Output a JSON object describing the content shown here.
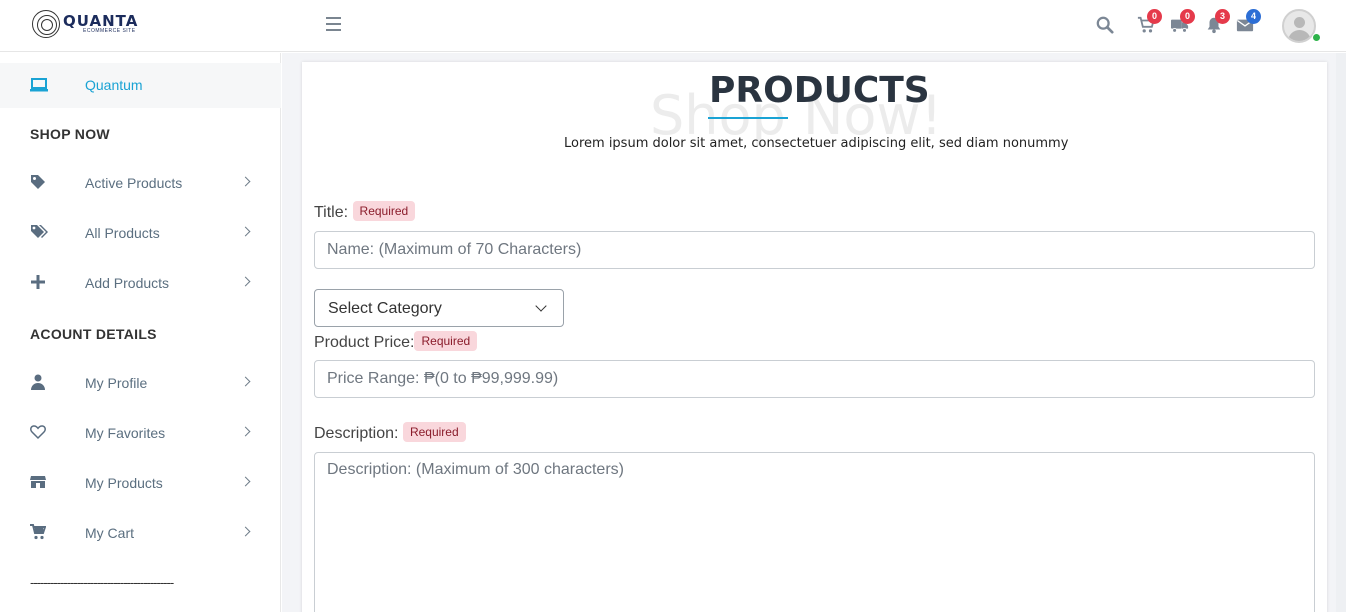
{
  "header": {
    "logo_name": "QUANTA",
    "logo_sub": "ECOMMERCE SITE",
    "badges": {
      "cart": "0",
      "delivery": "0",
      "notifications": "3",
      "messages": "4"
    },
    "colors": {
      "badge_red": "#e53a4b",
      "badge_blue": "#2c6ed5",
      "online": "#2eb34a"
    }
  },
  "sidebar": {
    "brand": "Quantum",
    "section_shop": "SHOP NOW",
    "shop_items": [
      {
        "label": "Active Products",
        "icon": "tag-icon"
      },
      {
        "label": "All Products",
        "icon": "tags-icon"
      },
      {
        "label": "Add Products",
        "icon": "plus-icon"
      }
    ],
    "section_account": "ACOUNT DETAILS",
    "account_items": [
      {
        "label": "My Profile",
        "icon": "user-icon"
      },
      {
        "label": "My Favorites",
        "icon": "heart-icon"
      },
      {
        "label": "My Products",
        "icon": "store-icon"
      },
      {
        "label": "My Cart",
        "icon": "cart-icon"
      }
    ],
    "divider": "-------------------------------------------"
  },
  "main": {
    "title": "PRODUCTS",
    "watermark": "Shop Now!",
    "subtitle": "Lorem ipsum dolor sit amet, consectetuer adipiscing elit, sed diam nonummy",
    "form": {
      "title_label": "Title:",
      "required": "Required",
      "title_placeholder": "Name: (Maximum of 70 Characters)",
      "category_value": "Select Category",
      "price_label": "Product Price:",
      "price_placeholder": "Price Range: ₱(0 to ₱99,999.99)",
      "description_label": "Description:",
      "description_placeholder": "Description: (Maximum of 300 characters)"
    },
    "accent_color": "#1aa3d4"
  }
}
